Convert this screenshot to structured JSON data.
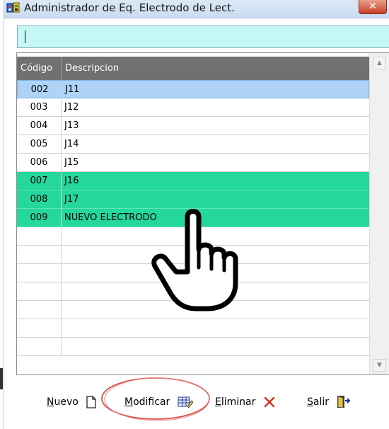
{
  "window": {
    "title": "Administrador de Eq. Electrodo de Lect.",
    "close_label": "✕"
  },
  "search": {
    "value": ""
  },
  "grid": {
    "columns": [
      "Código",
      "Descripcion"
    ],
    "rows": [
      {
        "code": "002",
        "desc": "J11",
        "state": "selected"
      },
      {
        "code": "003",
        "desc": "J12",
        "state": "normal"
      },
      {
        "code": "004",
        "desc": "J13",
        "state": "normal"
      },
      {
        "code": "005",
        "desc": "J14",
        "state": "normal"
      },
      {
        "code": "006",
        "desc": "J15",
        "state": "normal"
      },
      {
        "code": "007",
        "desc": "J16",
        "state": "highlighted"
      },
      {
        "code": "008",
        "desc": "J17",
        "state": "highlighted"
      },
      {
        "code": "009",
        "desc": "NUEVO ELECTRODO",
        "state": "highlighted"
      },
      {
        "code": "",
        "desc": "",
        "state": "empty"
      },
      {
        "code": "",
        "desc": "",
        "state": "empty"
      },
      {
        "code": "",
        "desc": "",
        "state": "empty"
      },
      {
        "code": "",
        "desc": "",
        "state": "empty"
      },
      {
        "code": "",
        "desc": "",
        "state": "empty"
      },
      {
        "code": "",
        "desc": "",
        "state": "empty"
      },
      {
        "code": "",
        "desc": "",
        "state": "empty"
      }
    ]
  },
  "toolbar": {
    "nuevo": {
      "u": "N",
      "rest": "uevo"
    },
    "modificar": {
      "u": "M",
      "rest": "odificar"
    },
    "eliminar": {
      "u": "E",
      "rest": "liminar"
    },
    "salir": {
      "u": "S",
      "rest": "alir"
    }
  },
  "colors": {
    "selected_row": "#aed3f6",
    "highlight_row": "#24d79c",
    "header": "#707070",
    "search_bg": "#c6f7f7",
    "annotation": "#d9534f"
  },
  "icons": [
    "app-window-icon",
    "close-icon",
    "scroll-up-icon",
    "scroll-down-icon",
    "new-document-icon",
    "edit-table-icon",
    "delete-x-icon",
    "exit-door-icon",
    "pointing-hand-cursor-icon"
  ]
}
